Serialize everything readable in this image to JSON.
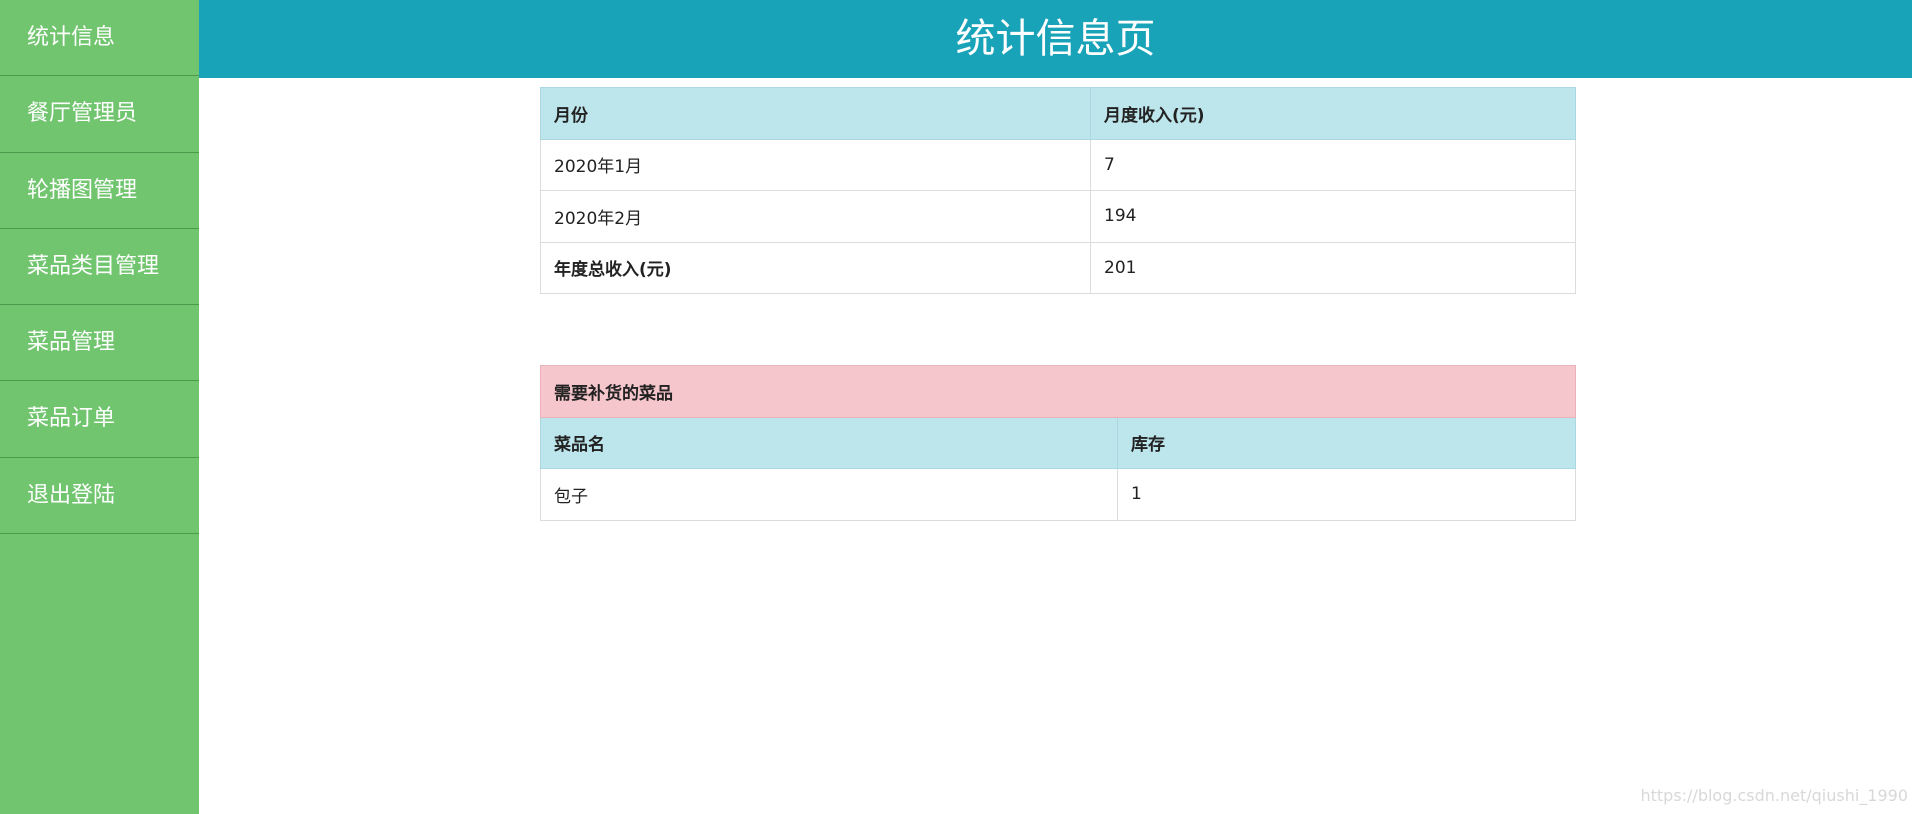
{
  "sidebar": {
    "items": [
      {
        "label": "统计信息"
      },
      {
        "label": "餐厅管理员"
      },
      {
        "label": "轮播图管理"
      },
      {
        "label": "菜品类目管理"
      },
      {
        "label": "菜品管理"
      },
      {
        "label": "菜品订单"
      },
      {
        "label": "退出登陆"
      }
    ]
  },
  "header": {
    "title": "统计信息页"
  },
  "income_table": {
    "headers": [
      "月份",
      "月度收入(元)"
    ],
    "rows": [
      {
        "month": "2020年1月",
        "income": "7"
      },
      {
        "month": "2020年2月",
        "income": "194"
      }
    ],
    "total_label": "年度总收入(元)",
    "total_value": "201"
  },
  "restock_table": {
    "caption": "需要补货的菜品",
    "headers": [
      "菜品名",
      "库存"
    ],
    "rows": [
      {
        "name": "包子",
        "stock": "1"
      }
    ]
  },
  "watermark": "https://blog.csdn.net/qiushi_1990",
  "colors": {
    "sidebar_bg": "#72c56f",
    "header_bg": "#18a3b8",
    "table_header_bg": "#bde5ec",
    "caption_bg": "#f6c6cd"
  }
}
